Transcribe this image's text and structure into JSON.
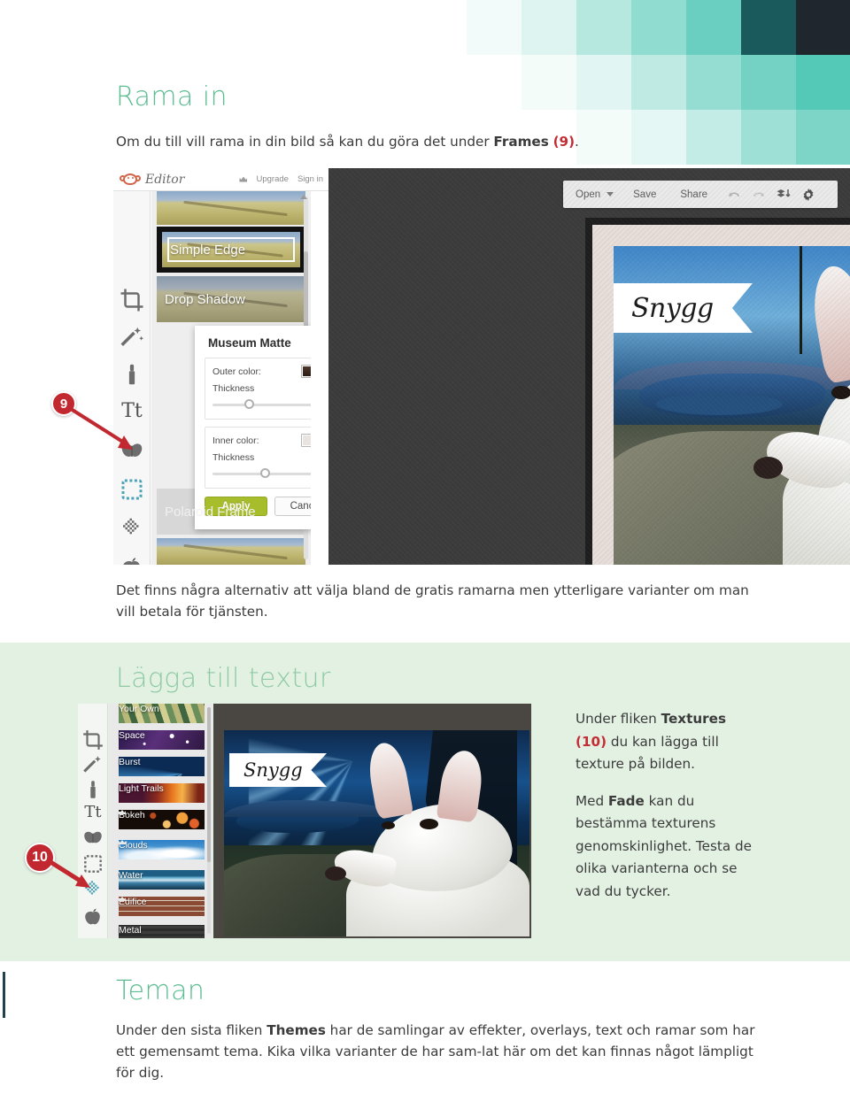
{
  "page": {
    "sections": [
      {
        "id": "rama-in",
        "heading": "Rama in",
        "intro_prefix": "Om du till vill rama in din bild så kan du göra det under ",
        "intro_bold": "Frames",
        "intro_ref": "(9)",
        "intro_suffix": ".",
        "caption": "Det finns några alternativ att välja bland de gratis ramarna men ytterligare varianter om man vill betala för tjänsten."
      },
      {
        "id": "lagga-till-textur",
        "heading": "Lägga till textur",
        "copy_1_prefix": "Under fliken ",
        "copy_1_bold": "Textures",
        "copy_1_ref": "(10)",
        "copy_1_suffix": " du kan lägga till texture på bilden.",
        "copy_2_prefix": "Med ",
        "copy_2_bold": "Fade",
        "copy_2_suffix": " kan du bestämma texturens genomskinlighet. Testa de olika varianterna och se vad du tycker."
      },
      {
        "id": "teman",
        "heading": "Teman",
        "copy_prefix": "Under den sista fliken ",
        "copy_bold": "Themes",
        "copy_suffix": " har de samlingar av effekter, overlays, text och ramar som har ett gemensamt tema. Kika vilka varianter de har sam-lat här om det kan finnas något lämpligt för dig."
      }
    ]
  },
  "callouts": [
    {
      "id": "callout-9",
      "label": "9"
    },
    {
      "id": "callout-10",
      "label": "10"
    }
  ],
  "editor_screenshot": {
    "brand": {
      "name": "Editor",
      "upgrade": "Upgrade",
      "signin": "Sign in"
    },
    "toolbar": {
      "open": "Open",
      "save": "Save",
      "share": "Share",
      "undo_icon": "undo-icon",
      "redo_icon": "redo-icon",
      "layers_icon": "layers-down-icon",
      "settings_icon": "gear-icon",
      "close": "✕"
    },
    "rail_icons": [
      "crop-icon",
      "magic-wand-icon",
      "touch-up-icon",
      "text-icon",
      "overlays-butterfly-icon",
      "frames-icon",
      "textures-icon",
      "themes-apple-icon"
    ],
    "frames_list": [
      {
        "label": "",
        "state": "partial"
      },
      {
        "label": "Simple Edge",
        "state": "selected"
      },
      {
        "label": "Drop Shadow",
        "state": "normal"
      },
      {
        "label": "Polaroid Frame",
        "state": "disabled"
      }
    ],
    "popup": {
      "title": "Museum Matte",
      "outer_color_label": "Outer color:",
      "outer_color_hex": "#3d2b22",
      "outer_thickness_label": "Thickness",
      "outer_thickness_value": "25",
      "inner_color_label": "Inner color:",
      "inner_color_hex": "#e9e4e0",
      "inner_thickness_label": "Thickness",
      "inner_thickness_value": "40",
      "apply": "Apply",
      "cancel": "Cancel"
    },
    "canvas": {
      "overlay_text": "Snygg"
    }
  },
  "textures_screenshot": {
    "rail_icons": [
      "crop-icon",
      "magic-wand-icon",
      "touch-up-icon",
      "text-icon",
      "overlays-butterfly-icon",
      "frames-icon",
      "textures-icon",
      "themes-apple-icon"
    ],
    "textures_list": [
      {
        "label": "Your Own",
        "premium": false
      },
      {
        "label": "Space",
        "premium": false
      },
      {
        "label": "Burst",
        "premium": false
      },
      {
        "label": "Light Trails",
        "premium": false
      },
      {
        "label": "Bokeh",
        "premium": true
      },
      {
        "label": "Clouds",
        "premium": true
      },
      {
        "label": "Water",
        "premium": false
      },
      {
        "label": "Edifice",
        "premium": true
      },
      {
        "label": "Metal",
        "premium": false
      }
    ],
    "canvas": {
      "overlay_text": "Snygg"
    }
  },
  "colors": {
    "heading_green": "#5cbd92",
    "heading_green_light": "#8ecaa4",
    "section_green_bg": "#e3f1e3",
    "callout_red": "#c2282f",
    "body_text": "#3b3b3b",
    "teal_accent": "#2bb5a5",
    "dark_accent": "#21414a"
  }
}
